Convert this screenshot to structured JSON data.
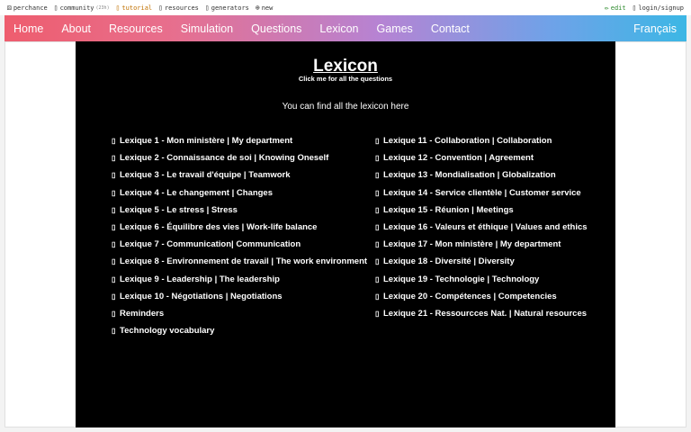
{
  "topbar": {
    "brand": "perchance",
    "community": "community",
    "community_count": "(23h)",
    "tutorial": "tutorial",
    "resources": "resources",
    "generators": "generators",
    "new": "new",
    "edit": "edit",
    "login": "login/signup"
  },
  "nav": {
    "items": [
      "Home",
      "About",
      "Resources",
      "Simulation",
      "Questions",
      "Lexicon",
      "Games",
      "Contact"
    ],
    "language": "Français"
  },
  "main": {
    "title": "Lexicon",
    "subtitle": "Click me for all the questions",
    "intro": "You can find all the lexicon here",
    "left_items": [
      "Lexique 1 - Mon ministère | My department",
      "Lexique 2 - Connaissance de soi | Knowing Oneself",
      "Lexique 3 - Le travail d'équipe | Teamwork",
      "Lexique 4 - Le changement | Changes",
      "Lexique 5 - Le stress | Stress",
      "Lexique 6 - Équilibre des vies | Work-life balance",
      "Lexique 7 - Communication| Communication",
      "Lexique 8 - Environnement de travail | The work environment",
      "Lexique 9 - Leadership | The leadership",
      "Lexique 10 - Négotiations | Negotiations",
      "Reminders",
      "Technology vocabulary"
    ],
    "right_items": [
      "Lexique 11 - Collaboration | Collaboration",
      "Lexique 12 - Convention | Agreement",
      "Lexique 13 - Mondialisation | Globalization",
      "Lexique 14 - Service clientèle | Customer service",
      "Lexique 15 - Réunion | Meetings",
      "Lexique 16 - Valeurs et éthique | Values and ethics",
      "Lexique 17 - Mon ministère | My department",
      "Lexique 18 - Diversité | Diversity",
      "Lexique 19 - Technologie | Technology",
      "Lexique 20 - Compétences | Competencies",
      "Lexique 21 - Ressourcces Nat. | Natural resources"
    ]
  },
  "colors": {
    "gradient_start": "#ee5d6e",
    "gradient_end": "#3cb7e5",
    "content_bg": "#000000",
    "tutorial": "#c07000",
    "edit": "#2b8a2b"
  },
  "icons": {
    "brand": "dice-icon",
    "community": "chat-icon",
    "tutorial": "book-icon",
    "resources": "book-icon",
    "generators": "list-icon",
    "new": "plus-icon",
    "edit": "pencil-icon",
    "login": "user-icon",
    "list_bullet": "document-icon"
  }
}
